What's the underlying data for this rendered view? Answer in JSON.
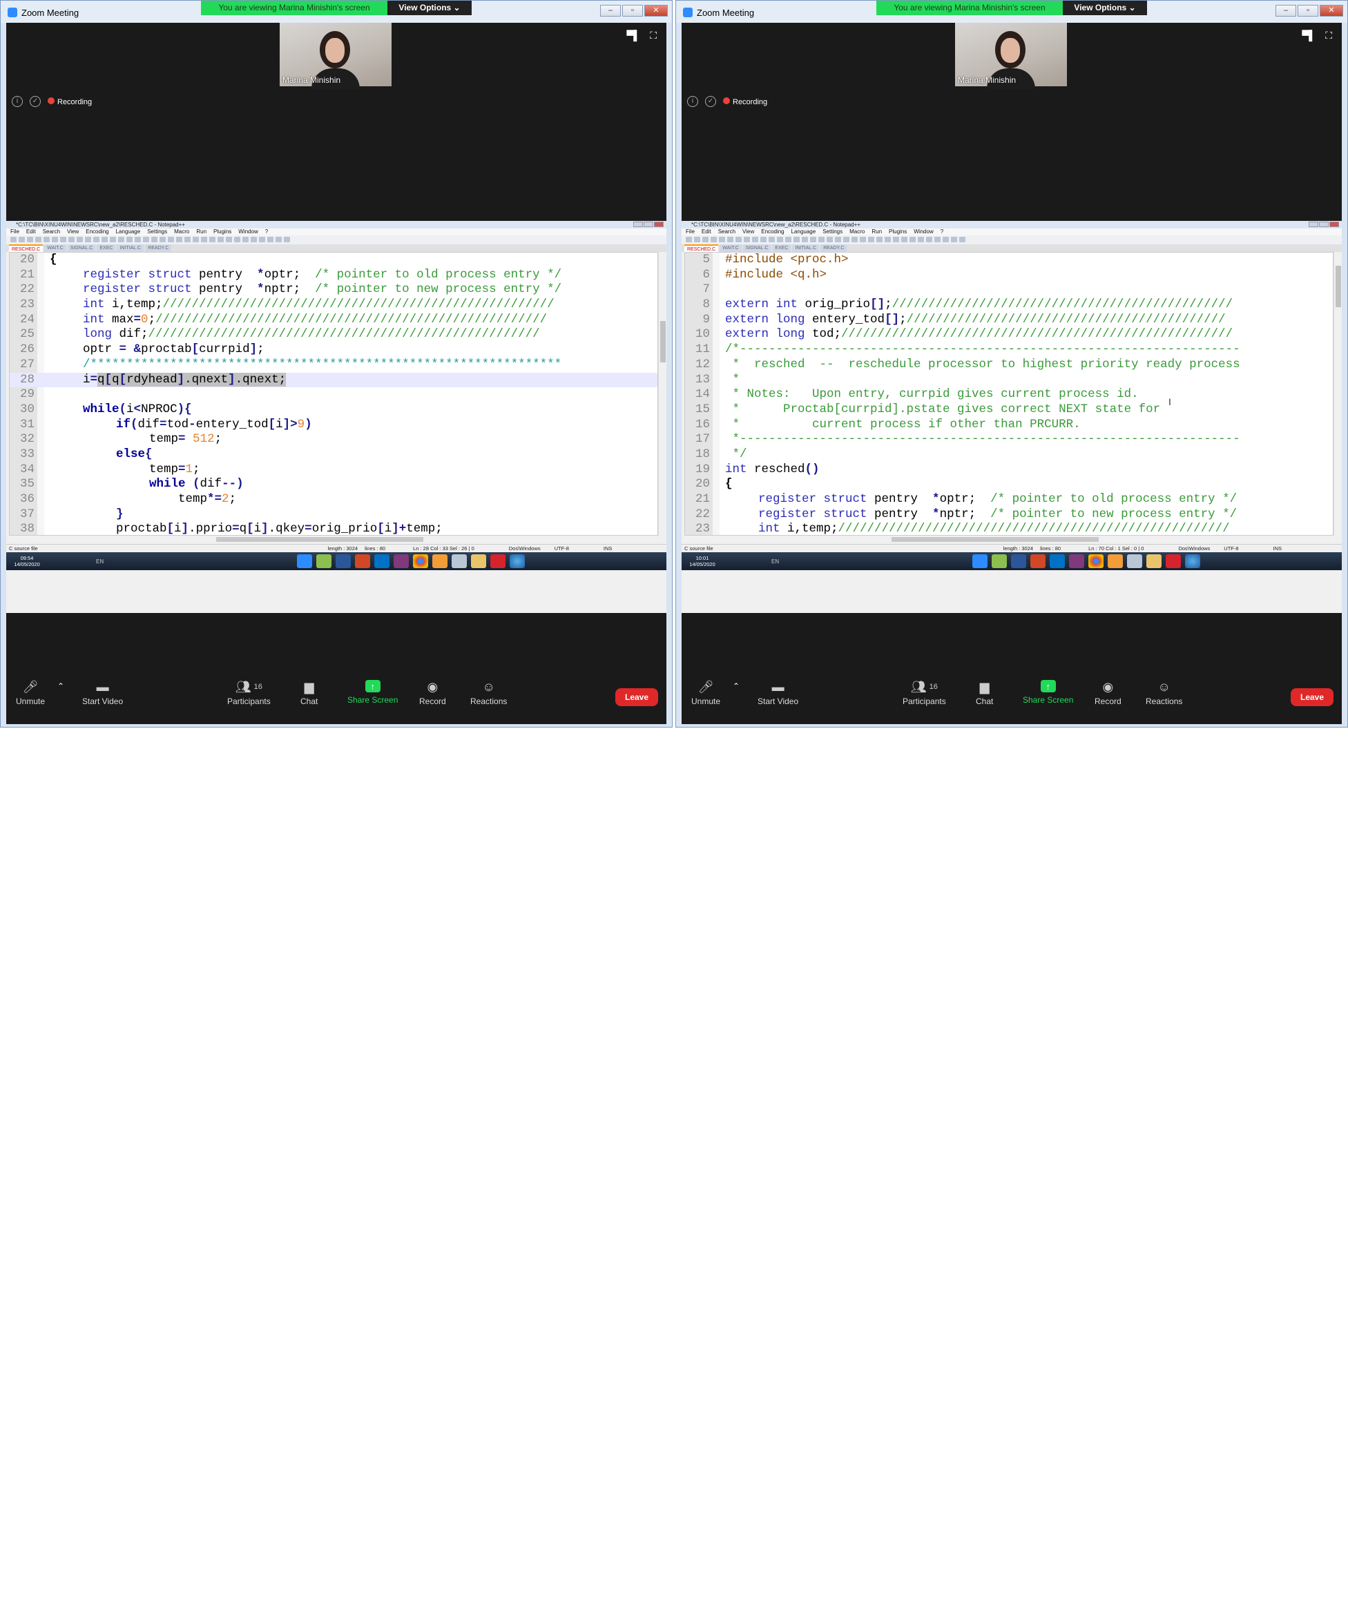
{
  "left": {
    "window_title": "Zoom Meeting",
    "viewing_banner": "You are viewing Marina Minishin's screen",
    "view_options": "View Options ⌄",
    "participant_name": "Marina Minishin",
    "recording_label": "Recording",
    "np_title": "*C:\\TC\\BIN\\XINU4WIN\\NEWSRC\\new_a2\\RESCHED.C - Notepad++",
    "menu": [
      "File",
      "Edit",
      "Search",
      "View",
      "Encoding",
      "Language",
      "Settings",
      "Macro",
      "Run",
      "Plugins",
      "Window",
      "?"
    ],
    "tabs": [
      "RESCHED.C",
      "WAIT.C",
      "SIGNAL.C",
      "EXEC",
      "INITIAL.C",
      "READY.C"
    ],
    "status": {
      "type": "C source file",
      "length": "length : 3024",
      "lines": "lines : 80",
      "pos": "Ln : 28    Col : 33    Sel : 26 | 0",
      "eol": "Dos\\Windows",
      "enc": "UTF-8",
      "mode": "INS"
    },
    "clock_time": "09:54",
    "clock_date": "14/05/2020",
    "lang": "EN"
  },
  "right": {
    "window_title": "Zoom Meeting",
    "viewing_banner": "You are viewing Marina Minishin's screen",
    "view_options": "View Options ⌄",
    "participant_name": "Marina Minishin",
    "recording_label": "Recording",
    "np_title": "*C:\\TC\\BIN\\XINU4WIN\\NEWSRC\\new_a2\\RESCHED.C - Notepad++",
    "menu": [
      "File",
      "Edit",
      "Search",
      "View",
      "Encoding",
      "Language",
      "Settings",
      "Macro",
      "Run",
      "Plugins",
      "Window",
      "?"
    ],
    "tabs": [
      "RESCHED.C",
      "WAIT.C",
      "SIGNAL.C",
      "EXEC",
      "INITIAL.C",
      "READY.C"
    ],
    "status": {
      "type": "C source file",
      "length": "length : 3024",
      "lines": "lines : 80",
      "pos": "Ln : 70    Col : 1    Sel : 0 | 0",
      "eol": "Dos\\Windows",
      "enc": "UTF-8",
      "mode": "INS"
    },
    "clock_time": "10:01",
    "clock_date": "14/05/2020",
    "lang": "EN"
  },
  "controls": {
    "unmute": "Unmute",
    "start_video": "Start Video",
    "participants": "Participants",
    "participants_count": "16",
    "chat": "Chat",
    "share_screen": "Share Screen",
    "record": "Record",
    "reactions": "Reactions",
    "leave": "Leave"
  },
  "code_left": [
    {
      "n": "20",
      "html": "<span class='br'>{</span>",
      "ind": 0
    },
    {
      "n": "21",
      "html": "<span class='kw'>register struct</span> pentry  <span class='op'>*</span>optr;  <span class='cm'>/* pointer to old process entry */</span>",
      "ind": 1
    },
    {
      "n": "22",
      "html": "<span class='kw'>register struct</span> pentry  <span class='op'>*</span>nptr;  <span class='cm'>/* pointer to new process entry */</span>",
      "ind": 1
    },
    {
      "n": "23",
      "html": "<span class='kw'>int</span> i,temp;<span class='cm'>//////////////////////////////////////////////////////</span>",
      "ind": 1
    },
    {
      "n": "24",
      "html": "<span class='kw'>int</span> max<span class='op'>=</span><span class='num'>0</span>;<span class='cm'>//////////////////////////////////////////////////////</span>",
      "ind": 1
    },
    {
      "n": "25",
      "html": "<span class='kw'>long</span> dif;<span class='cm'>//////////////////////////////////////////////////////</span>",
      "ind": 1
    },
    {
      "n": "26",
      "html": "optr <span class='op'>=</span> <span class='op'>&amp;</span>proctab<span class='op'>[</span>currpid<span class='op'>]</span>;",
      "ind": 1
    },
    {
      "n": "27",
      "html": "<span class='cm' style='color:#2a9a9a'>/*****************************************************************</span>",
      "ind": 1
    },
    {
      "n": "28",
      "html": "i<span class='op'>=</span><span class='sel'>q<span class='op'>[</span>q<span class='op'>[</span>rdyhead<span class='op'>]</span>.qnext<span class='op'>]</span>.qnext;</span>",
      "ind": 1,
      "hl": true
    },
    {
      "n": "29",
      "html": "",
      "ind": 1
    },
    {
      "n": "30",
      "html": "<span class='st'>while</span><span class='op'>(</span>i<span class='op'>&lt;</span>NPROC<span class='op'>){</span>",
      "ind": 1
    },
    {
      "n": "31",
      "html": "<span class='st'>if</span><span class='op'>(</span>dif<span class='op'>=</span>tod<span class='op'>-</span>entery_tod<span class='op'>[</span>i<span class='op'>]&gt;</span><span class='num'>9</span><span class='op'>)</span>",
      "ind": 2
    },
    {
      "n": "32",
      "html": "temp<span class='op'>=</span> <span class='num'>512</span>;",
      "ind": 3
    },
    {
      "n": "33",
      "html": "<span class='st'>else</span><span class='op'>{</span>",
      "ind": 2
    },
    {
      "n": "34",
      "html": "temp<span class='op'>=</span><span class='num'>1</span>;",
      "ind": 3
    },
    {
      "n": "35",
      "html": "<span class='st'>while</span> <span class='op'>(</span>dif<span class='op'>--)</span>",
      "ind": 3
    },
    {
      "n": "36",
      "html": "    temp<span class='op'>*=</span><span class='num'>2</span>;",
      "ind": 3
    },
    {
      "n": "37",
      "html": "<span class='op'>}</span>",
      "ind": 2
    },
    {
      "n": "38",
      "html": "proctab<span class='op'>[</span>i<span class='op'>]</span>.pprio<span class='op'>=</span>q<span class='op'>[</span>i<span class='op'>]</span>.qkey<span class='op'>=</span>orig_prio<span class='op'>[</span>i<span class='op'>]+</span>temp;",
      "ind": 2
    }
  ],
  "code_right": [
    {
      "n": "5",
      "html": "<span class='pp'>#include &lt;proc.h&gt;</span>",
      "ind": 0
    },
    {
      "n": "6",
      "html": "<span class='pp'>#include &lt;q.h&gt;</span>",
      "ind": 0
    },
    {
      "n": "7",
      "html": "",
      "ind": 0
    },
    {
      "n": "8",
      "html": "<span class='kw'>extern int</span> orig_prio<span class='op'>[]</span>;<span class='cm'>///////////////////////////////////////////////</span>",
      "ind": 0
    },
    {
      "n": "9",
      "html": "<span class='kw'>extern long</span> entery_tod<span class='op'>[]</span>;<span class='cm'>////////////////////////////////////////////</span>",
      "ind": 0
    },
    {
      "n": "10",
      "html": "<span class='kw'>extern long</span> tod;<span class='cm'>//////////////////////////////////////////////////////</span>",
      "ind": 0
    },
    {
      "n": "11",
      "html": "<span class='cm'>/*---------------------------------------------------------------------</span>",
      "ind": 0
    },
    {
      "n": "12",
      "html": "<span class='cm'> *  resched  --  reschedule processor to highest priority ready process</span>",
      "ind": 0
    },
    {
      "n": "13",
      "html": "<span class='cm'> *</span>",
      "ind": 0
    },
    {
      "n": "14",
      "html": "<span class='cm'> * Notes:   Upon entry, currpid gives current process id.</span>",
      "ind": 0
    },
    {
      "n": "15",
      "html": "<span class='cm'> *      Proctab[currpid].pstate gives correct NEXT state for</span>",
      "ind": 0
    },
    {
      "n": "16",
      "html": "<span class='cm'> *          current process if other than PRCURR.</span>",
      "ind": 0
    },
    {
      "n": "17",
      "html": "<span class='cm'> *---------------------------------------------------------------------</span>",
      "ind": 0
    },
    {
      "n": "18",
      "html": "<span class='cm'> */</span>",
      "ind": 0
    },
    {
      "n": "19",
      "html": "<span class='kw'>int</span> resched<span class='op'>()</span>",
      "ind": 0
    },
    {
      "n": "20",
      "html": "<span class='br'>{</span>",
      "ind": 0
    },
    {
      "n": "21",
      "html": "<span class='kw'>register struct</span> pentry  <span class='op'>*</span>optr;  <span class='cm'>/* pointer to old process entry */</span>",
      "ind": 1
    },
    {
      "n": "22",
      "html": "<span class='kw'>register struct</span> pentry  <span class='op'>*</span>nptr;  <span class='cm'>/* pointer to new process entry */</span>",
      "ind": 1
    },
    {
      "n": "23",
      "html": "<span class='kw'>int</span> i,temp;<span class='cm'>//////////////////////////////////////////////////////</span>",
      "ind": 1
    }
  ]
}
